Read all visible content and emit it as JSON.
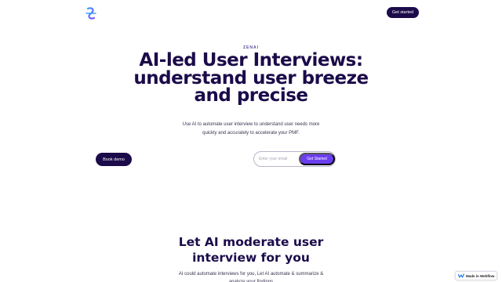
{
  "nav": {
    "logo_icon": "zenai-logo-icon",
    "cta_label": "Get started"
  },
  "hero": {
    "eyebrow": "ZENAI",
    "title": "AI-led User Interviews: understand user breeze and precise",
    "subtitle": "Use AI to automate user interview to understand user needs more quickly and accurately to accelerate your PMF.",
    "demo_label": "Book demo",
    "email_placeholder": "Enter your email",
    "signup_label": "Get Started"
  },
  "section": {
    "title": "Let AI moderate user interview for you",
    "subtitle": "AI could automate interviews for you, Let AI automate & summarize & analyze your findings"
  },
  "badge": {
    "label": "Made in Webflow",
    "icon": "webflow-icon"
  },
  "colors": {
    "primary_dark": "#1b0b4a",
    "accent_purple": "#6a3df0",
    "logo_blue": "#3aa0ff"
  }
}
